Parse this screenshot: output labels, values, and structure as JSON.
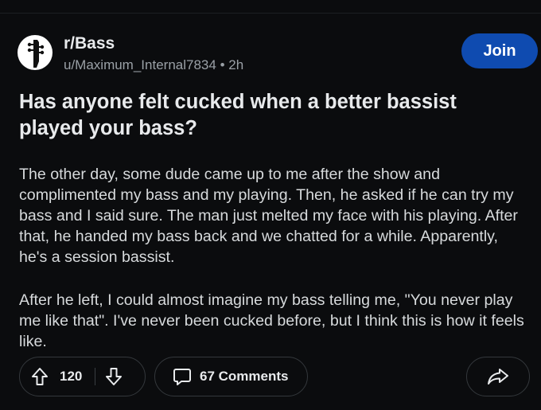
{
  "header": {
    "subreddit": "r/Bass",
    "author": "u/Maximum_Internal7834",
    "separator": "•",
    "age": "2h",
    "join_label": "Join",
    "join_color": "#0f4bb0",
    "avatar_icon": "bass-guitar-headstock-icon"
  },
  "post": {
    "title": "Has anyone felt cucked when a better bassist played your bass?",
    "paragraphs": [
      "The other day, some dude came up to me after the show and complimented my bass and my playing. Then, he asked if he can try my bass and I said sure. The man just melted my face with his playing. After that, he handed my bass back and we chatted for a while. Apparently, he's a session bassist.",
      "After he left, I could almost imagine my bass telling me, \"You never play me like that\". I've never been cucked before, but I think this is how it feels like."
    ]
  },
  "actions": {
    "score": "120",
    "comments_label": "67 Comments",
    "upvote_icon": "arrow-up-icon",
    "downvote_icon": "arrow-down-icon",
    "comment_icon": "comment-bubble-icon",
    "share_icon": "share-arrow-icon"
  }
}
